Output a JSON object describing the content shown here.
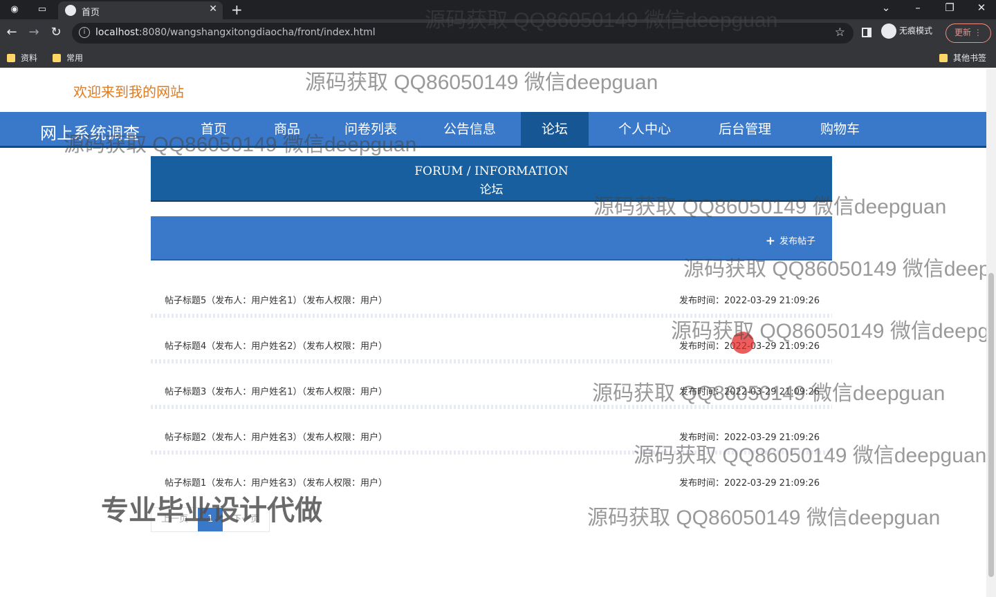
{
  "browser": {
    "tab_title": "首页",
    "url_host": "localhost",
    "url_rest": ":8080/wangshangxitongdiaocha/front/index.html",
    "incognito_label": "无痕模式",
    "update_label": "更新",
    "bookmarks": [
      "资料",
      "常用"
    ],
    "other_bookmarks": "其他书签"
  },
  "site": {
    "welcome": "欢迎来到我的网站",
    "brand": "网上系统调查",
    "nav": [
      {
        "label": "首页"
      },
      {
        "label": "商品"
      },
      {
        "label": "问卷列表"
      },
      {
        "label": "公告信息"
      },
      {
        "label": "论坛"
      },
      {
        "label": "个人中心"
      },
      {
        "label": "后台管理"
      },
      {
        "label": "购物车"
      }
    ],
    "active_nav": "论坛"
  },
  "forum": {
    "heading_en": "FORUM / INFORMATION",
    "heading_zh": "论坛",
    "post_button": "发布帖子",
    "posts": [
      {
        "title": "帖子标题5（发布人：用户姓名1）（发布人权限：用户）",
        "time": "发布时间：2022-03-29 21:09:26"
      },
      {
        "title": "帖子标题4（发布人：用户姓名2）（发布人权限：用户）",
        "time": "发布时间：2022-03-29 21:09:26"
      },
      {
        "title": "帖子标题3（发布人：用户姓名1）（发布人权限：用户）",
        "time": "发布时间：2022-03-29 21:09:26"
      },
      {
        "title": "帖子标题2（发布人：用户姓名3）（发布人权限：用户）",
        "time": "发布时间：2022-03-29 21:09:26"
      },
      {
        "title": "帖子标题1（发布人：用户姓名3）（发布人权限：用户）",
        "time": "发布时间：2022-03-29 21:09:26"
      }
    ],
    "pager": {
      "prev": "上一页",
      "current": "1",
      "next": "下一页"
    }
  },
  "watermarks": {
    "text": "源码获取 QQ86050149 微信deepguan",
    "big": "专业毕业设计代做"
  }
}
